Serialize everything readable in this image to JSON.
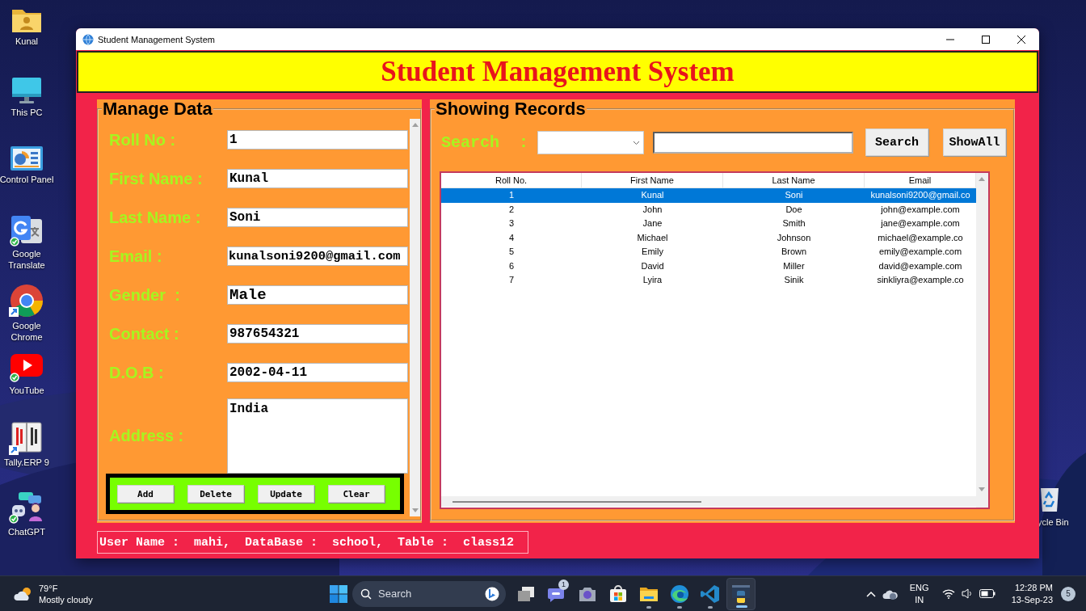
{
  "desktop": {
    "icons": [
      {
        "kind": "user-folder",
        "label": "Kunal"
      },
      {
        "kind": "monitor",
        "label": "This PC"
      },
      {
        "kind": "control-panel",
        "label": "Control Panel"
      },
      {
        "kind": "translate",
        "label": "Google Translate"
      },
      {
        "kind": "chrome",
        "label": "Google Chrome"
      },
      {
        "kind": "youtube",
        "label": "YouTube"
      },
      {
        "kind": "tally",
        "label": "Tally.ERP 9"
      },
      {
        "kind": "chatgpt",
        "label": "ChatGPT"
      }
    ],
    "recycle_bin": {
      "label": "ycle Bin"
    }
  },
  "window": {
    "title": "Student Management System",
    "heading": "Student Management System",
    "manage": {
      "title": "Manage Data",
      "fields": [
        {
          "kind": "entry",
          "label": "Roll No :",
          "value": "1"
        },
        {
          "kind": "entry",
          "label": "First Name :",
          "value": "Kunal"
        },
        {
          "kind": "entry",
          "label": "Last Name :",
          "value": "Soni"
        },
        {
          "kind": "entry",
          "label": "Email :",
          "value": "kunalsoni9200@gmail.com"
        },
        {
          "kind": "large",
          "label": "Gender  :",
          "value": "Male"
        },
        {
          "kind": "entry",
          "label": "Contact :",
          "value": "987654321"
        },
        {
          "kind": "entry",
          "label": "D.O.B :",
          "value": "2002-04-11"
        },
        {
          "kind": "text",
          "label": "Address :",
          "value": "India"
        }
      ],
      "buttons": [
        "Add",
        "Delete",
        "Update",
        "Clear"
      ]
    },
    "records": {
      "title": "Showing Records",
      "search": {
        "label": "Search  :",
        "button": "Search",
        "show_all": "ShowAll"
      },
      "table": {
        "columns": [
          "Roll No.",
          "First Name",
          "Last Name",
          "Email"
        ],
        "rows": [
          {
            "cells": [
              "1",
              "Kunal",
              "Soni",
              "kunalsoni9200@gmail.co"
            ],
            "selected": true
          },
          {
            "cells": [
              "2",
              "John",
              "Doe",
              "john@example.com"
            ],
            "selected": false
          },
          {
            "cells": [
              "3",
              "Jane",
              "Smith",
              "jane@example.com"
            ],
            "selected": false
          },
          {
            "cells": [
              "4",
              "Michael",
              "Johnson",
              "michael@example.co"
            ],
            "selected": false
          },
          {
            "cells": [
              "5",
              "Emily",
              "Brown",
              "emily@example.com"
            ],
            "selected": false
          },
          {
            "cells": [
              "6",
              "David",
              "Miller",
              "david@example.com"
            ],
            "selected": false
          },
          {
            "cells": [
              "7",
              "Lyira",
              "Sinik",
              "sinkliyra@example.co"
            ],
            "selected": false
          }
        ]
      }
    },
    "status": "User Name :  mahi,  DataBase :  school,  Table :  class12"
  },
  "taskbar": {
    "weather": {
      "temperature": "79°F",
      "condition": "Mostly cloudy"
    },
    "search": {
      "placeholder": "Search"
    },
    "apps": [
      {
        "kind": "task-view",
        "running": false,
        "active": false
      },
      {
        "kind": "chat",
        "running": false,
        "active": false,
        "badge": "1"
      },
      {
        "kind": "camera",
        "running": false,
        "active": false
      },
      {
        "kind": "store",
        "running": false,
        "active": false
      },
      {
        "kind": "explorer",
        "running": true,
        "active": false
      },
      {
        "kind": "edge",
        "running": true,
        "active": false
      },
      {
        "kind": "vscode",
        "running": true,
        "active": false
      },
      {
        "kind": "python",
        "running": true,
        "active": true
      }
    ],
    "language": [
      "ENG",
      "IN"
    ],
    "time": "12:28 PM",
    "date": "13-Sep-23",
    "notifications": "5"
  }
}
